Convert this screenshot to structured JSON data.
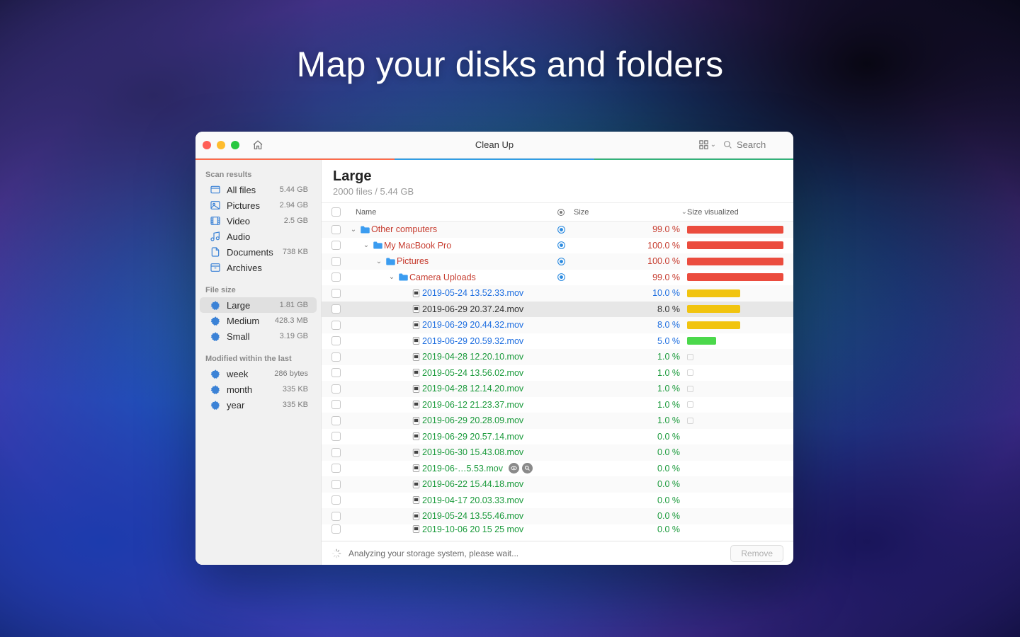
{
  "hero": "Map your disks and folders",
  "window": {
    "title": "Clean Up",
    "search_placeholder": "Search",
    "accent_colors": [
      "#ff6b4a",
      "#2f9ee6",
      "#32b37a"
    ]
  },
  "sidebar": {
    "sections": [
      {
        "title": "Scan results",
        "items": [
          {
            "icon": "all-files-icon",
            "label": "All files",
            "size": "5.44 GB"
          },
          {
            "icon": "pictures-icon",
            "label": "Pictures",
            "size": "2.94 GB"
          },
          {
            "icon": "video-icon",
            "label": "Video",
            "size": "2.5 GB"
          },
          {
            "icon": "audio-icon",
            "label": "Audio",
            "size": ""
          },
          {
            "icon": "documents-icon",
            "label": "Documents",
            "size": "738 KB"
          },
          {
            "icon": "archives-icon",
            "label": "Archives",
            "size": ""
          }
        ]
      },
      {
        "title": "File size",
        "items": [
          {
            "icon": "gear-icon",
            "label": "Large",
            "size": "1.81 GB",
            "active": true
          },
          {
            "icon": "gear-icon",
            "label": "Medium",
            "size": "428.3 MB"
          },
          {
            "icon": "gear-icon",
            "label": "Small",
            "size": "3.19 GB"
          }
        ]
      },
      {
        "title": "Modified within the last",
        "items": [
          {
            "icon": "gear-icon",
            "label": "week",
            "size": "286 bytes"
          },
          {
            "icon": "gear-icon",
            "label": "month",
            "size": "335 KB"
          },
          {
            "icon": "gear-icon",
            "label": "year",
            "size": "335 KB"
          }
        ]
      }
    ]
  },
  "content": {
    "title": "Large",
    "subtitle": "2000 files / 5.44 GB",
    "columns": {
      "name": "Name",
      "size": "Size",
      "viz": "Size visualized"
    },
    "rows": [
      {
        "d": 0,
        "disclose": "down",
        "folder": "blue",
        "name": "Other computers",
        "nc": "c-red",
        "dot": true,
        "pct": "99.0 %",
        "pc": "c-red",
        "bar": 100,
        "bc": "#eb4c3e"
      },
      {
        "d": 1,
        "disclose": "down",
        "folder": "blue",
        "name": "My MacBook Pro",
        "nc": "c-red",
        "dot": true,
        "pct": "100.0 %",
        "pc": "c-red",
        "bar": 100,
        "bc": "#eb4c3e"
      },
      {
        "d": 2,
        "disclose": "down",
        "folder": "blue",
        "name": "Pictures",
        "nc": "c-red",
        "dot": true,
        "pct": "100.0 %",
        "pc": "c-red",
        "bar": 100,
        "bc": "#eb4c3e"
      },
      {
        "d": 3,
        "disclose": "down",
        "folder": "blue",
        "name": "Camera Uploads",
        "nc": "c-red",
        "dot": true,
        "pct": "99.0 %",
        "pc": "c-red",
        "bar": 100,
        "bc": "#eb4c3e"
      },
      {
        "d": 4,
        "file": "mov",
        "name": "2019-05-24 13.52.33.mov",
        "nc": "c-blue",
        "pct": "10.0 %",
        "pc": "c-blue",
        "bar": 55,
        "bc": "#f1c40f"
      },
      {
        "d": 4,
        "file": "mov",
        "name": "2019-06-29 20.37.24.mov",
        "nc": "c-dark",
        "pct": "8.0 %",
        "pc": "c-dark",
        "bar": 55,
        "bc": "#f1c40f",
        "selected": true
      },
      {
        "d": 4,
        "file": "mov",
        "name": "2019-06-29 20.44.32.mov",
        "nc": "c-blue",
        "pct": "8.0 %",
        "pc": "c-blue",
        "bar": 55,
        "bc": "#f1c40f"
      },
      {
        "d": 4,
        "file": "mov",
        "name": "2019-06-29 20.59.32.mov",
        "nc": "c-blue",
        "pct": "5.0 %",
        "pc": "c-blue",
        "bar": 30,
        "bc": "#4bd84b"
      },
      {
        "d": 4,
        "file": "mov",
        "name": "2019-04-28 12.20.10.mov",
        "nc": "c-green",
        "pct": "1.0 %",
        "pc": "c-green",
        "tiny": true
      },
      {
        "d": 4,
        "file": "mov",
        "name": "2019-05-24 13.56.02.mov",
        "nc": "c-green",
        "pct": "1.0 %",
        "pc": "c-green",
        "tiny": true
      },
      {
        "d": 4,
        "file": "mov",
        "name": "2019-04-28 12.14.20.mov",
        "nc": "c-green",
        "pct": "1.0 %",
        "pc": "c-green",
        "tiny": true
      },
      {
        "d": 4,
        "file": "mov",
        "name": "2019-06-12 21.23.37.mov",
        "nc": "c-green",
        "pct": "1.0 %",
        "pc": "c-green",
        "tiny": true
      },
      {
        "d": 4,
        "file": "mov",
        "name": "2019-06-29 20.28.09.mov",
        "nc": "c-green",
        "pct": "1.0 %",
        "pc": "c-green",
        "tiny": true
      },
      {
        "d": 4,
        "file": "mov",
        "name": "2019-06-29 20.57.14.mov",
        "nc": "c-green",
        "pct": "0.0 %",
        "pc": "c-green"
      },
      {
        "d": 4,
        "file": "mov",
        "name": "2019-06-30 15.43.08.mov",
        "nc": "c-green",
        "pct": "0.0 %",
        "pc": "c-green"
      },
      {
        "d": 4,
        "file": "mov",
        "name": "2019-06-…5.53.mov",
        "nc": "c-green",
        "pct": "0.0 %",
        "pc": "c-green",
        "hover": true
      },
      {
        "d": 4,
        "file": "mov",
        "name": "2019-06-22 15.44.18.mov",
        "nc": "c-green",
        "pct": "0.0 %",
        "pc": "c-green"
      },
      {
        "d": 4,
        "file": "mov",
        "name": "2019-04-17 20.03.33.mov",
        "nc": "c-green",
        "pct": "0.0 %",
        "pc": "c-green"
      },
      {
        "d": 4,
        "file": "mov",
        "name": "2019-05-24 13.55.46.mov",
        "nc": "c-green",
        "pct": "0.0 %",
        "pc": "c-green"
      },
      {
        "d": 4,
        "file": "mov",
        "name": "2019-10-06 20 15 25 mov",
        "nc": "c-green",
        "pct": "0.0 %",
        "pc": "c-green",
        "cut": true
      }
    ]
  },
  "footer": {
    "status": "Analyzing your storage system, please wait...",
    "remove": "Remove"
  }
}
